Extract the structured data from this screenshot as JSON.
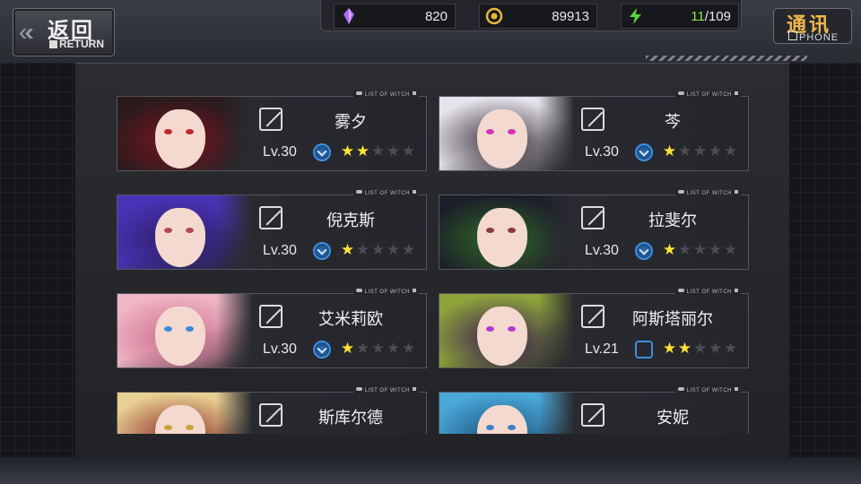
{
  "header": {
    "return_cn": "返回",
    "return_en": "RETURN",
    "phone_cn": "通讯",
    "phone_en": "PHONE"
  },
  "resources": [
    {
      "name": "crystal",
      "icon": "purple-crystal-icon",
      "color": "#b06cff",
      "value": "820"
    },
    {
      "name": "coin",
      "icon": "gold-coin-icon",
      "color": "#e8b838",
      "value": "89913"
    },
    {
      "name": "energy",
      "icon": "green-energy-icon",
      "color": "#5ad43c",
      "current": "11",
      "max": "/109"
    }
  ],
  "card_tag": "LIST OF WITCH",
  "witches": [
    {
      "name": "雾夕",
      "level": "Lv.30",
      "stars": 2,
      "rank_style": "filled",
      "hair": "#2a1a1c",
      "eye": "#c0262d",
      "accent": "#7a1620"
    },
    {
      "name": "芩",
      "level": "Lv.30",
      "stars": 1,
      "rank_style": "filled",
      "hair": "#e6e3ea",
      "eye": "#d233b5",
      "accent": "#3a3038"
    },
    {
      "name": "倪克斯",
      "level": "Lv.30",
      "stars": 1,
      "rank_style": "filled",
      "hair": "#4b33b8",
      "eye": "#b6465a",
      "accent": "#2a1e62"
    },
    {
      "name": "拉斐尔",
      "level": "Lv.30",
      "stars": 1,
      "rank_style": "filled",
      "hair": "#1c1f2a",
      "eye": "#8a3a3a",
      "accent": "#2f6a26"
    },
    {
      "name": "艾米莉欧",
      "level": "Lv.30",
      "stars": 1,
      "rank_style": "filled",
      "hair": "#f0b6c6",
      "eye": "#3a8ad8",
      "accent": "#c96a88"
    },
    {
      "name": "阿斯塔丽尔",
      "level": "Lv.21",
      "stars": 2,
      "rank_style": "hex",
      "hair": "#8ea43a",
      "eye": "#b23ad0",
      "accent": "#3a1d52"
    },
    {
      "name": "斯库尔德",
      "level": "",
      "stars": 0,
      "rank_style": "none",
      "hair": "#e8cf92",
      "eye": "#c9a23b",
      "accent": "#8c2a2a"
    },
    {
      "name": "安妮",
      "level": "",
      "stars": 0,
      "rank_style": "none",
      "hair": "#49a8d8",
      "eye": "#3b7fc8",
      "accent": "#1d4f7a"
    }
  ]
}
